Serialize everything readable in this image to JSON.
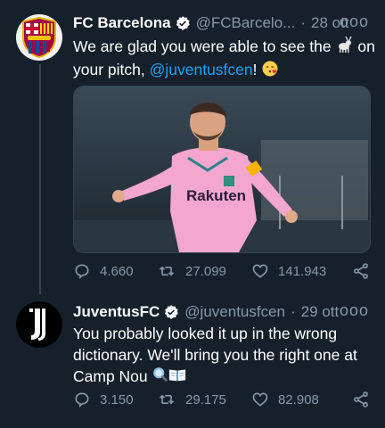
{
  "colors": {
    "background": "#15202b",
    "text": "#ffffff",
    "secondary": "#8899a6",
    "link": "#1da1f2",
    "verified": "#ffffff"
  },
  "tweets": [
    {
      "author": "FC Barcelona",
      "handle": "@FCBarcelo...",
      "dot": "·",
      "date": "28 ott",
      "more": "ooo",
      "text_before": "We are glad you were able to see the",
      "text_mid": "on your pitch,",
      "mention": "@juventusfcen",
      "text_after": "!",
      "emoji_goat": "goat-emoji",
      "emoji_kiss": "kissing-heart-emoji",
      "media_text": "Rakuten",
      "replies": "4.660",
      "retweets": "27.099",
      "likes": "141.943"
    },
    {
      "author": "JuventusFC",
      "handle": "@juventusfcen",
      "dot": "·",
      "date": "29 ott",
      "more": "ooo",
      "text": "You probably looked it up in the wrong dictionary. We'll bring you the right one at Camp Nou",
      "emoji_magnifier": "magnifying-glass-emoji",
      "emoji_book": "open-book-emoji",
      "replies": "3.150",
      "retweets": "29.175",
      "likes": "82.908"
    }
  ]
}
